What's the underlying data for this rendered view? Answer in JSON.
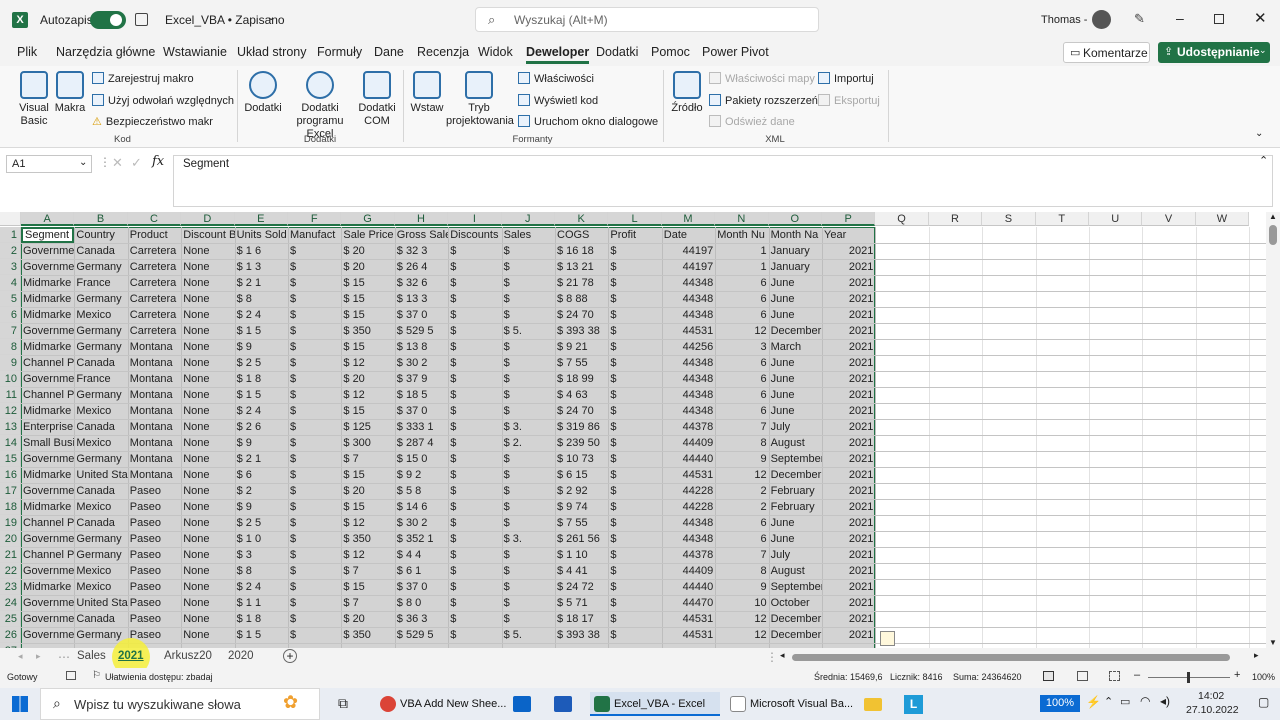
{
  "titlebar": {
    "autosave_label": "Autozapis",
    "file_title": "Excel_VBA • Zapisano",
    "search_placeholder": "Wyszukaj (Alt+M)",
    "user_name": "Thomas -"
  },
  "menu": {
    "items": [
      "Plik",
      "Narzędzia główne",
      "Wstawianie",
      "Układ strony",
      "Formuły",
      "Dane",
      "Recenzja",
      "Widok",
      "Deweloper",
      "Dodatki",
      "Pomoc",
      "Power Pivot"
    ],
    "active": "Deweloper",
    "comments_label": "Komentarze",
    "share_label": "Udostępnianie"
  },
  "ribbon": {
    "code": {
      "visual_basic": "Visual Basic",
      "macros": "Makra",
      "record_macro": "Zarejestruj makro",
      "relative_refs": "Użyj odwołań względnych",
      "macro_security": "Bezpieczeństwo makr",
      "group_label": "Kod"
    },
    "addins": {
      "addins": "Dodatki",
      "excel_addins": "Dodatki programu Excel",
      "com_addins": "Dodatki COM",
      "group_label": "Dodatki"
    },
    "controls": {
      "insert": "Wstaw",
      "design_mode": "Tryb projektowania",
      "properties": "Właściwości",
      "view_code": "Wyświetl kod",
      "run_dialog": "Uruchom okno dialogowe",
      "group_label": "Formanty"
    },
    "xml": {
      "source": "Źródło",
      "map_properties": "Właściwości mapy",
      "expansion_packs": "Pakiety rozszerzeń",
      "refresh_data": "Odśwież dane",
      "import": "Importuj",
      "export": "Eksportuj",
      "group_label": "XML"
    }
  },
  "formula_bar": {
    "name_box": "A1",
    "fx": "fx",
    "content": "Segment"
  },
  "columns": [
    "A",
    "B",
    "C",
    "D",
    "E",
    "F",
    "G",
    "H",
    "I",
    "J",
    "K",
    "L",
    "M",
    "N",
    "O",
    "P",
    "Q",
    "R",
    "S",
    "T",
    "U",
    "V",
    "W"
  ],
  "headers": [
    "Segment",
    "Country",
    "Product",
    "Discount B",
    "Units Sold",
    "Manufact",
    "Sale Price",
    "Gross Sale",
    "Discounts",
    "Sales",
    "COGS",
    "Profit",
    "Date",
    "Month Nu",
    "Month Na",
    "Year"
  ],
  "rows": [
    [
      "Governme",
      "Canada",
      "Carretera",
      "None",
      "$      1 6",
      "$",
      "$       20",
      "$   32 3",
      "$",
      "$",
      "$   16 18",
      "$",
      "44197",
      "1",
      "January",
      "2021"
    ],
    [
      "Governme",
      "Germany",
      "Carretera",
      "None",
      "$      1 3",
      "$",
      "$       20",
      "$   26 4",
      "$",
      "$",
      "$   13 21",
      "$",
      "44197",
      "1",
      "January",
      "2021"
    ],
    [
      "Midmarke",
      "France",
      "Carretera",
      "None",
      "$      2 1",
      "$",
      "$       15",
      "$   32 6",
      "$",
      "$",
      "$   21 78",
      "$",
      "44348",
      "6",
      "June",
      "2021"
    ],
    [
      "Midmarke",
      "Germany",
      "Carretera",
      "None",
      "$        8",
      "$",
      "$       15",
      "$   13 3",
      "$",
      "$",
      "$    8 88",
      "$",
      "44348",
      "6",
      "June",
      "2021"
    ],
    [
      "Midmarke",
      "Mexico",
      "Carretera",
      "None",
      "$      2 4",
      "$",
      "$       15",
      "$   37 0",
      "$",
      "$",
      "$   24 70",
      "$",
      "44348",
      "6",
      "June",
      "2021"
    ],
    [
      "Governme",
      "Germany",
      "Carretera",
      "None",
      "$      1 5",
      "$",
      "$     350",
      "$  529 5",
      "$",
      "$      5.",
      "$  393 38",
      "$",
      "44531",
      "12",
      "December",
      "2021"
    ],
    [
      "Midmarke",
      "Germany",
      "Montana",
      "None",
      "$        9",
      "$",
      "$       15",
      "$   13 8",
      "$",
      "$",
      "$    9 21",
      "$",
      "44256",
      "3",
      "March",
      "2021"
    ],
    [
      "Channel Pa",
      "Canada",
      "Montana",
      "None",
      "$      2 5",
      "$",
      "$       12",
      "$   30 2",
      "$",
      "$",
      "$    7 55",
      "$",
      "44348",
      "6",
      "June",
      "2021"
    ],
    [
      "Governme",
      "France",
      "Montana",
      "None",
      "$      1 8",
      "$",
      "$       20",
      "$   37 9",
      "$",
      "$",
      "$   18 99",
      "$",
      "44348",
      "6",
      "June",
      "2021"
    ],
    [
      "Channel Pa",
      "Germany",
      "Montana",
      "None",
      "$      1 5",
      "$",
      "$       12",
      "$   18 5",
      "$",
      "$",
      "$    4 63",
      "$",
      "44348",
      "6",
      "June",
      "2021"
    ],
    [
      "Midmarke",
      "Mexico",
      "Montana",
      "None",
      "$      2 4",
      "$",
      "$       15",
      "$   37 0",
      "$",
      "$",
      "$   24 70",
      "$",
      "44348",
      "6",
      "June",
      "2021"
    ],
    [
      "Enterprise",
      "Canada",
      "Montana",
      "None",
      "$      2 6",
      "$",
      "$     125",
      "$  333 1",
      "$",
      "$      3.",
      "$  319 86",
      "$",
      "44378",
      "7",
      "July",
      "2021"
    ],
    [
      "Small Busi",
      "Mexico",
      "Montana",
      "None",
      "$        9",
      "$",
      "$     300",
      "$  287 4",
      "$",
      "$      2.",
      "$  239 50",
      "$",
      "44409",
      "8",
      "August",
      "2021"
    ],
    [
      "Governme",
      "Germany",
      "Montana",
      "None",
      "$      2 1",
      "$",
      "$         7",
      "$   15 0",
      "$",
      "$",
      "$   10 73",
      "$",
      "44440",
      "9",
      "September",
      "2021"
    ],
    [
      "Midmarke",
      "United Sta",
      "Montana",
      "None",
      "$        6",
      "$",
      "$       15",
      "$    9 2",
      "$",
      "$",
      "$    6 15",
      "$",
      "44531",
      "12",
      "December",
      "2021"
    ],
    [
      "Governme",
      "Canada",
      "Paseo",
      "None",
      "$        2",
      "$",
      "$       20",
      "$    5 8",
      "$",
      "$",
      "$    2 92",
      "$",
      "44228",
      "2",
      "February",
      "2021"
    ],
    [
      "Midmarke",
      "Mexico",
      "Paseo",
      "None",
      "$        9",
      "$",
      "$       15",
      "$   14 6",
      "$",
      "$",
      "$    9 74",
      "$",
      "44228",
      "2",
      "February",
      "2021"
    ],
    [
      "Channel Pa",
      "Canada",
      "Paseo",
      "None",
      "$      2 5",
      "$",
      "$       12",
      "$   30 2",
      "$",
      "$",
      "$    7 55",
      "$",
      "44348",
      "6",
      "June",
      "2021"
    ],
    [
      "Governme",
      "Germany",
      "Paseo",
      "None",
      "$      1 0",
      "$",
      "$     350",
      "$  352 1",
      "$",
      "$      3.",
      "$  261 56",
      "$",
      "44348",
      "6",
      "June",
      "2021"
    ],
    [
      "Channel Pa",
      "Germany",
      "Paseo",
      "None",
      "$        3",
      "$",
      "$       12",
      "$    4 4",
      "$",
      "$",
      "$    1 10",
      "$",
      "44378",
      "7",
      "July",
      "2021"
    ],
    [
      "Governme",
      "Mexico",
      "Paseo",
      "None",
      "$        8",
      "$",
      "$         7",
      "$    6 1",
      "$",
      "$",
      "$    4 41",
      "$",
      "44409",
      "8",
      "August",
      "2021"
    ],
    [
      "Midmarke",
      "Mexico",
      "Paseo",
      "None",
      "$      2 4",
      "$",
      "$       15",
      "$   37 0",
      "$",
      "$",
      "$   24 72",
      "$",
      "44440",
      "9",
      "September",
      "2021"
    ],
    [
      "Governme",
      "United Sta",
      "Paseo",
      "None",
      "$      1 1",
      "$",
      "$         7",
      "$    8 0",
      "$",
      "$",
      "$    5 71",
      "$",
      "44470",
      "10",
      "October",
      "2021"
    ],
    [
      "Governme",
      "Canada",
      "Paseo",
      "None",
      "$      1 8",
      "$",
      "$       20",
      "$   36 3",
      "$",
      "$",
      "$   18 17",
      "$",
      "44531",
      "12",
      "December",
      "2021"
    ],
    [
      "Governme",
      "Germany",
      "Paseo",
      "None",
      "$      1 5",
      "$",
      "$     350",
      "$  529 5",
      "$",
      "$      5.",
      "$  393 38",
      "$",
      "44531",
      "12",
      "December",
      "2021"
    ]
  ],
  "sheet_tabs": [
    "Sales",
    "2021",
    "Arkusz20",
    "2020"
  ],
  "active_tab": "2021",
  "status": {
    "ready": "Gotowy",
    "accessibility": "Ułatwienia dostępu: zbadaj",
    "average": "Średnia: 15469,6",
    "count": "Licznik: 8416",
    "sum": "Suma: 24364620",
    "zoom": "100%"
  },
  "taskbar": {
    "search_placeholder": "Wpisz tu wyszukiwane słowa",
    "apps": [
      "VBA Add New Shee...",
      "Excel_VBA - Excel",
      "Microsoft Visual Ba..."
    ],
    "battery": "100%",
    "time": "14:02",
    "date": "27.10.2022"
  },
  "colors": {
    "excel_green": "#217346",
    "selection_fill": "#d4d4d4",
    "highlight_yellow": "#f5ef3a"
  }
}
